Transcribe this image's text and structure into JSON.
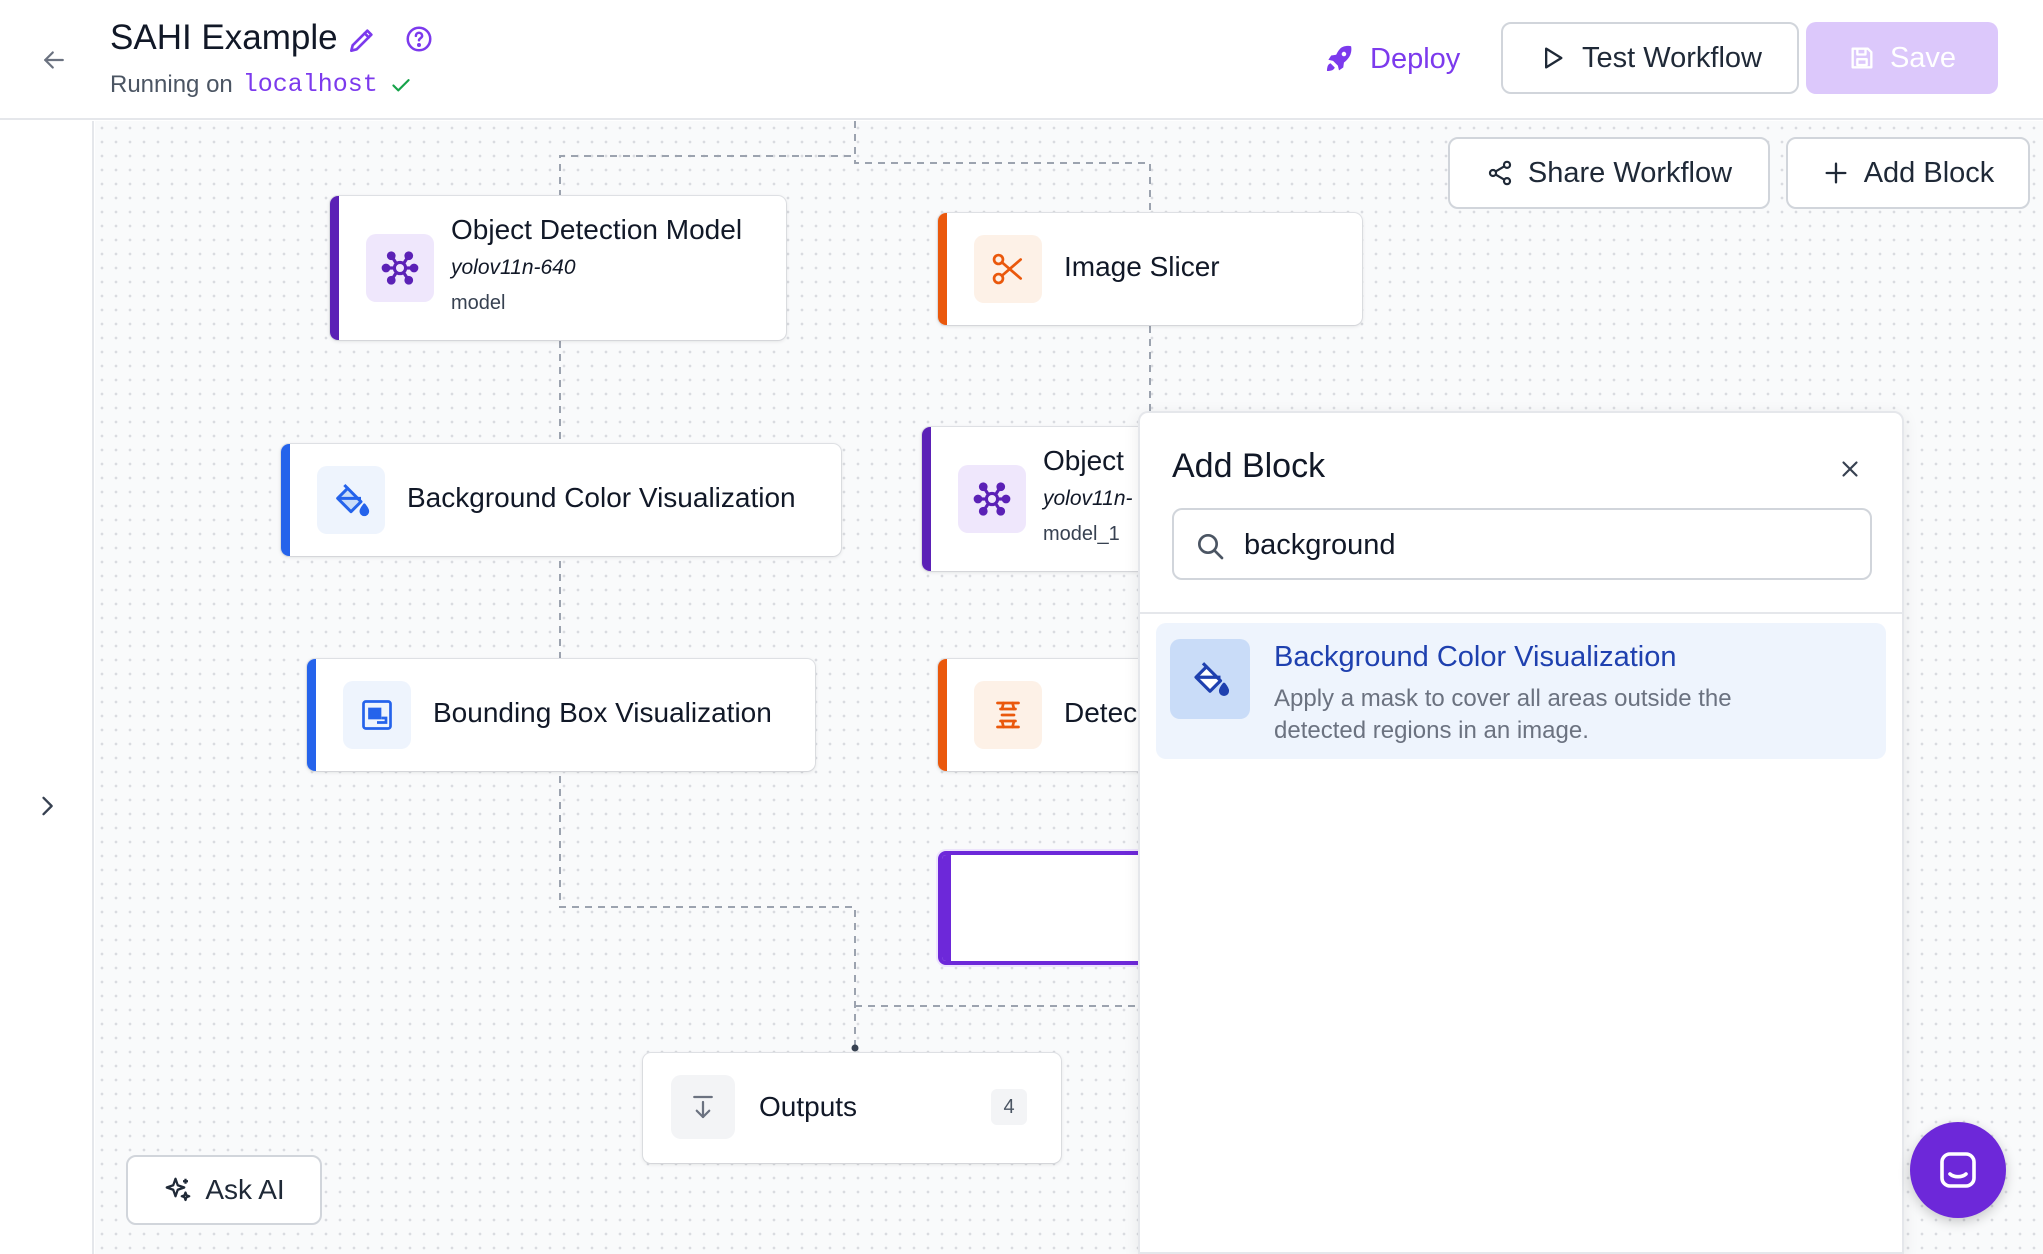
{
  "header": {
    "title": "SAHI Example",
    "status_prefix": "Running on",
    "status_host": "localhost",
    "deploy_label": "Deploy",
    "test_label": "Test Workflow",
    "save_label": "Save"
  },
  "canvas": {
    "share_label": "Share Workflow",
    "add_block_label": "Add Block",
    "ask_ai_label": "Ask AI",
    "nodes": {
      "od_model": {
        "label": "Object Detection Model",
        "model": "yolov11n-640",
        "name": "model"
      },
      "image_slicer": {
        "label": "Image Slicer"
      },
      "bg_color_viz": {
        "label": "Background Color Visualization"
      },
      "od_model_1": {
        "label": "Object",
        "model": "yolov11n-",
        "name": "model_1"
      },
      "bbox_viz": {
        "label": "Bounding Box Visualization"
      },
      "detections_stitch": {
        "label": "Detec"
      },
      "outputs": {
        "label": "Outputs",
        "count": "4"
      }
    }
  },
  "add_block_panel": {
    "title": "Add Block",
    "search_value": "background",
    "results": [
      {
        "title": "Background Color Visualization",
        "description": "Apply a mask to cover all areas outside the detected regions in an image."
      }
    ]
  },
  "colors": {
    "accent": "#7c3aed",
    "model_bar": "#5b21b6",
    "viz_bar": "#2563eb",
    "transform_bar": "#ea580c",
    "save_disabled": "#dcc8fb"
  }
}
